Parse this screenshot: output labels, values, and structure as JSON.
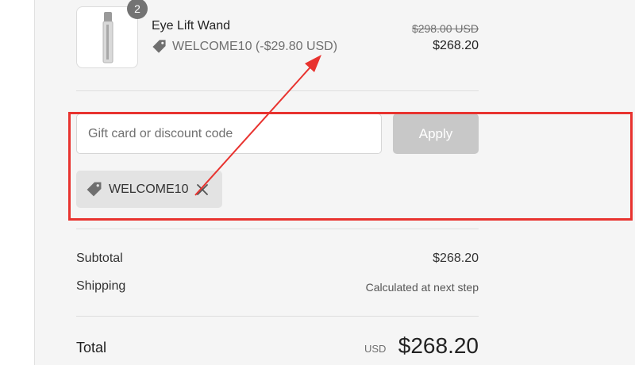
{
  "product": {
    "quantity": "2",
    "name": "Eye Lift Wand",
    "discount_text": "WELCOME10 (-$29.80 USD)",
    "original_price": "$298.00 USD",
    "price": "$268.20"
  },
  "discount_form": {
    "placeholder": "Gift card or discount code",
    "apply_label": "Apply",
    "applied_code": "WELCOME10"
  },
  "summary": {
    "subtotal_label": "Subtotal",
    "subtotal_value": "$268.20",
    "shipping_label": "Shipping",
    "shipping_value": "Calculated at next step",
    "total_label": "Total",
    "total_currency": "USD",
    "total_value": "$268.20"
  },
  "icons": {
    "discount_tag": "tag-icon",
    "remove": "close-icon"
  },
  "colors": {
    "annotation_red": "#e8332f",
    "apply_button_disabled": "#c8c8c8",
    "panel_background": "#f5f5f5"
  }
}
